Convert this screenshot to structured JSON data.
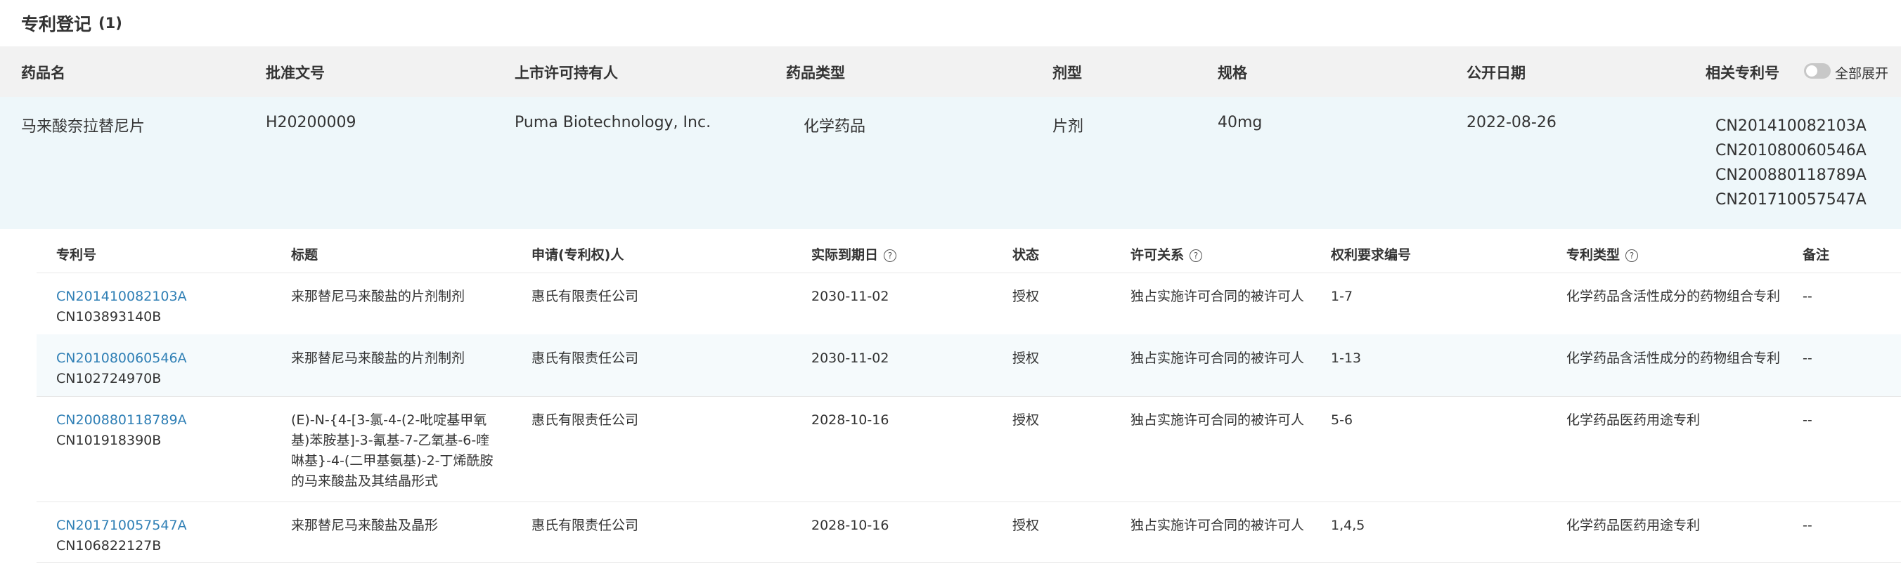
{
  "section": {
    "title": "专利登记",
    "count": "(1)"
  },
  "outer_table": {
    "headers": {
      "drug_name": "药品名",
      "approval_no": "批准文号",
      "holder": "上市许可持有人",
      "drug_type": "药品类型",
      "dosage_form": "剂型",
      "spec": "规格",
      "publish_date": "公开日期",
      "related_patents": "相关专利号",
      "expand_all": "全部展开"
    },
    "row": {
      "drug_name": "马来酸奈拉替尼片",
      "approval_no": "H20200009",
      "holder": "Puma Biotechnology, Inc.",
      "drug_type": "化学药品",
      "dosage_form": "片剂",
      "spec": "40mg",
      "publish_date": "2022-08-26",
      "related_patents": [
        "CN201410082103A",
        "CN201080060546A",
        "CN200880118789A",
        "CN201710057547A"
      ]
    },
    "expand_toggle_on": false
  },
  "inner_table": {
    "headers": {
      "patent_no": "专利号",
      "title": "标题",
      "applicant": "申请(专利权)人",
      "expiry": "实际到期日",
      "status": "状态",
      "license": "许可关系",
      "claims": "权利要求编号",
      "patent_type": "专利类型",
      "remarks": "备注"
    },
    "rows": [
      {
        "patent_no": "CN201410082103A",
        "patent_sub": "CN103893140B",
        "title": "来那替尼马来酸盐的片剂制剂",
        "applicant": "惠氏有限责任公司",
        "expiry": "2030-11-02",
        "status": "授权",
        "license": "独占实施许可合同的被许可人",
        "claims": "1-7",
        "patent_type": "化学药品含活性成分的药物组合专利",
        "remarks": "--"
      },
      {
        "patent_no": "CN201080060546A",
        "patent_sub": "CN102724970B",
        "title": "来那替尼马来酸盐的片剂制剂",
        "applicant": "惠氏有限责任公司",
        "expiry": "2030-11-02",
        "status": "授权",
        "license": "独占实施许可合同的被许可人",
        "claims": "1-13",
        "patent_type": "化学药品含活性成分的药物组合专利",
        "remarks": "--"
      },
      {
        "patent_no": "CN200880118789A",
        "patent_sub": "CN101918390B",
        "title": "(E)-N-{4-[3-氯-4-(2-吡啶基甲氧基)苯胺基]-3-氰基-7-乙氧基-6-喹啉基}-4-(二甲基氨基)-2-丁烯酰胺的马来酸盐及其结晶形式",
        "applicant": "惠氏有限责任公司",
        "expiry": "2028-10-16",
        "status": "授权",
        "license": "独占实施许可合同的被许可人",
        "claims": "5-6",
        "patent_type": "化学药品医药用途专利",
        "remarks": "--"
      },
      {
        "patent_no": "CN201710057547A",
        "patent_sub": "CN106822127B",
        "title": "来那替尼马来酸盐及晶形",
        "applicant": "惠氏有限责任公司",
        "expiry": "2028-10-16",
        "status": "授权",
        "license": "独占实施许可合同的被许可人",
        "claims": "1,4,5",
        "patent_type": "化学药品医药用途专利",
        "remarks": "--"
      }
    ]
  },
  "colors": {
    "link": "#2f7fb5",
    "header_bg": "#f2f2f2",
    "highlight_row_bg": "#eef7fa"
  }
}
